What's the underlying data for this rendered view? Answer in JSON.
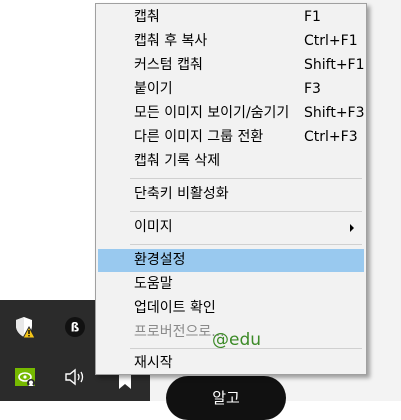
{
  "menu": {
    "items": [
      {
        "label": "캡춰",
        "shortcut": "F1"
      },
      {
        "label": "캡춰 후 복사",
        "shortcut": "Ctrl+F1"
      },
      {
        "label": "커스텀 캡춰",
        "shortcut": "Shift+F1"
      },
      {
        "label": "붙이기",
        "shortcut": "F3"
      },
      {
        "label": "모든 이미지 보이기/숨기기",
        "shortcut": "Shift+F3"
      },
      {
        "label": "다른 이미지 그룹 전환",
        "shortcut": "Ctrl+F3"
      },
      {
        "label": "캡춰 기록 삭제",
        "shortcut": ""
      },
      {
        "label": "단축키 비활성화",
        "shortcut": ""
      },
      {
        "label": "이미지",
        "shortcut": ""
      },
      {
        "label": "환경설정",
        "shortcut": ""
      },
      {
        "label": "도움말",
        "shortcut": ""
      },
      {
        "label": "업데이트 확인",
        "shortcut": ""
      },
      {
        "label": "프로버전으로...",
        "shortcut": ""
      },
      {
        "label": "재시작",
        "shortcut": ""
      }
    ],
    "selected_index": 9,
    "disabled_index": 12
  },
  "watermark": "@edu",
  "background_button": "알고",
  "colors": {
    "selection": "#99c9ef",
    "menu_bg": "#f2f2f2",
    "tray_bg": "#2b2b2b",
    "watermark": "#3c8a27"
  },
  "icons": [
    "security-warning-icon",
    "app-tray-icon",
    "nvidia-icon",
    "volume-icon",
    "bookmark-icon",
    "submenu-arrow-icon"
  ]
}
